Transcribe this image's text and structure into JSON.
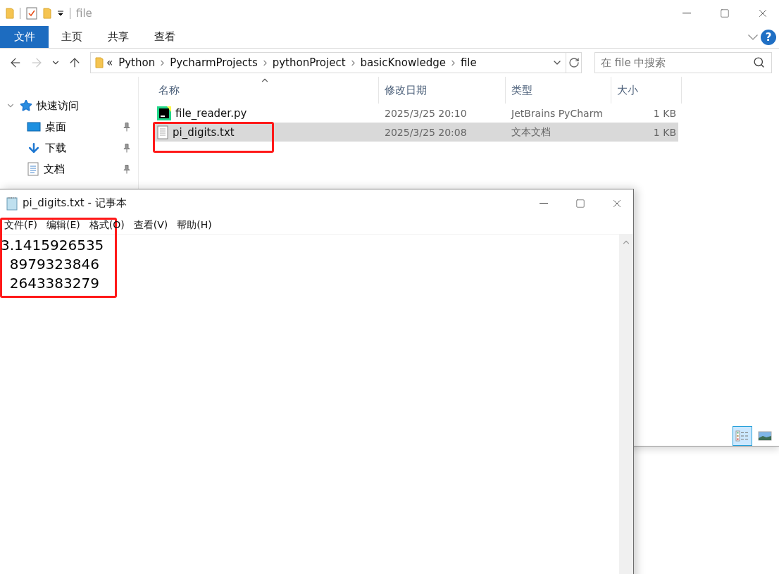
{
  "explorer": {
    "title": "file",
    "ribbon_tabs": [
      {
        "label": "文件",
        "selected": true
      },
      {
        "label": "主页",
        "selected": false
      },
      {
        "label": "共享",
        "selected": false
      },
      {
        "label": "查看",
        "selected": false
      }
    ],
    "help": "?",
    "address": {
      "overflow": "«",
      "crumbs": [
        "Python",
        "PycharmProjects",
        "pythonProject",
        "basicKnowledge",
        "file"
      ]
    },
    "search": {
      "placeholder": "在 file 中搜索"
    },
    "nav": {
      "header": "快速访问",
      "items": [
        {
          "label": "桌面",
          "kind": "desktop",
          "pinned": true
        },
        {
          "label": "下载",
          "kind": "download",
          "pinned": true
        },
        {
          "label": "文档",
          "kind": "document",
          "pinned": true
        }
      ]
    },
    "columns": [
      "名称",
      "修改日期",
      "类型",
      "大小"
    ],
    "files": [
      {
        "name": "file_reader.py",
        "kind": "pycharm",
        "modified": "2025/3/25 20:10",
        "type": "JetBrains PyCharm",
        "size": "1 KB",
        "selected": false
      },
      {
        "name": "pi_digits.txt",
        "kind": "text",
        "modified": "2025/3/25 20:08",
        "type": "文本文档",
        "size": "1 KB",
        "selected": true
      }
    ],
    "views": [
      {
        "kind": "details",
        "selected": true
      },
      {
        "kind": "thumbnails",
        "selected": false
      }
    ]
  },
  "notepad": {
    "title": "pi_digits.txt - 记事本",
    "menu": [
      "文件(F)",
      "编辑(E)",
      "格式(O)",
      "查看(V)",
      "帮助(H)"
    ],
    "lines": [
      "3.1415926535",
      "  8979323846",
      "  2643383279"
    ]
  }
}
